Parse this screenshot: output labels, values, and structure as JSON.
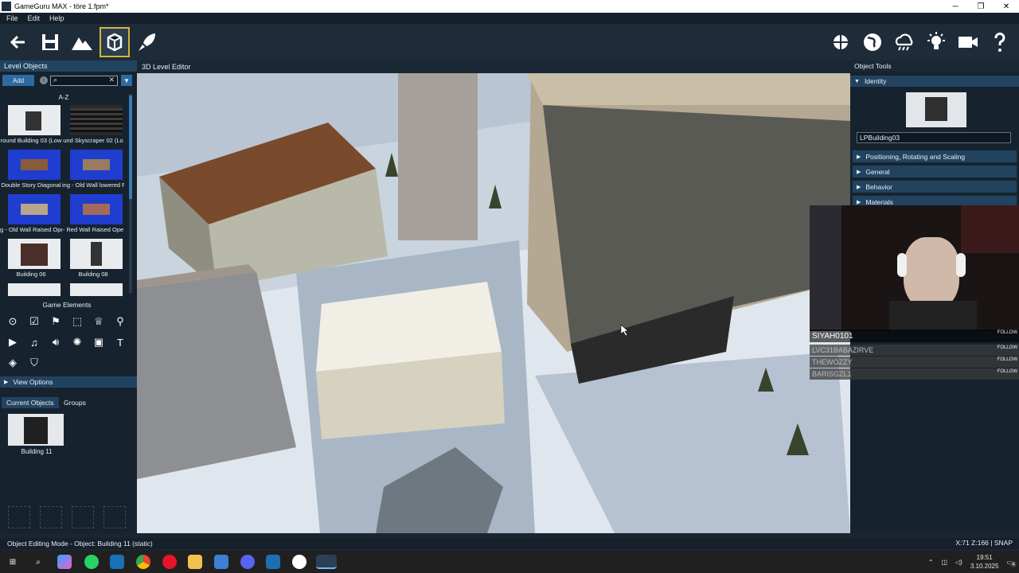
{
  "window": {
    "title": "GameGuru MAX - töre 1.fpm*",
    "controls": [
      "─",
      "❐",
      "✕"
    ]
  },
  "menu": [
    "File",
    "Edit",
    "Help"
  ],
  "toolbar": {
    "left": [
      "back-icon",
      "save-icon",
      "terrain-icon",
      "object-editing-icon",
      "test-game-icon"
    ],
    "active": "object-editing-icon",
    "right": [
      "widget-icon",
      "globe-icon",
      "weather-icon",
      "light-icon",
      "camera-icon",
      "help-icon"
    ]
  },
  "level_objects": {
    "title": "Level Objects",
    "add_label": "Add",
    "search_value": "",
    "sort_label": "A-Z",
    "items": [
      {
        "label": "round Building 03 (Low",
        "color": "#e9ecee"
      },
      {
        "label": "und Skyscraper 02 (Lo",
        "color": "#2a2a2a"
      },
      {
        "label": "Double Story Diagonal",
        "color": "#1f3ed0"
      },
      {
        "label": "ing - Old Wall lowered F",
        "color": "#1f3ed0"
      },
      {
        "label": "g - Old Wall Raised Ope",
        "color": "#1f3ed0"
      },
      {
        "label": "- Red Wall Raised Ope",
        "color": "#1f3ed0"
      },
      {
        "label": "Building 06",
        "color": "#e9ecee"
      },
      {
        "label": "Building 08",
        "color": "#e9ecee"
      },
      {
        "label": "",
        "color": "#e9ecee"
      },
      {
        "label": "",
        "color": "#e9ecee"
      }
    ]
  },
  "game_elements": {
    "title": "Game Elements",
    "icons": [
      "marker-icon",
      "checkbox-icon",
      "flag-icon",
      "zone-icon",
      "trophy-icon",
      "spawn-icon",
      "play-icon",
      "music-icon",
      "sound-icon",
      "particle-icon",
      "image-icon",
      "text-icon",
      "water-icon",
      "shield-icon"
    ]
  },
  "view_options": {
    "label": "View Options"
  },
  "current_tabs": [
    "Current Objects",
    "Groups"
  ],
  "current_objects": [
    {
      "label": "Building 11"
    }
  ],
  "viewport": {
    "title": "3D Level Editor"
  },
  "object_tools": {
    "title": "Object Tools",
    "identity_label": "Identity",
    "object_name": "LPBuilding03",
    "sections": [
      "Positioning, Rotating and Scaling",
      "General",
      "Behavior",
      "Materials"
    ]
  },
  "stream": {
    "followers": [
      {
        "name": "SIYAH0101",
        "action": "FOLLOW"
      },
      {
        "name": "LVC31BABAZIRVE",
        "action": "FOLLOW"
      },
      {
        "name": "THEWOZZY",
        "action": "FOLLOW"
      },
      {
        "name": "BARISGZL1",
        "action": "FOLLOW"
      }
    ]
  },
  "status": {
    "mode": "Object Editing Mode - Object: Building 11 (static)",
    "coords": "X:71 Z:166 | SNAP"
  },
  "taskbar": {
    "apps": [
      "windows",
      "search",
      "copilot",
      "whatsapp",
      "steam",
      "chrome",
      "opera",
      "explorer",
      "store",
      "discord",
      "steam2",
      "github",
      "gameguru"
    ],
    "time": "19:51",
    "date": "3.10.2025",
    "notifications": "4"
  }
}
